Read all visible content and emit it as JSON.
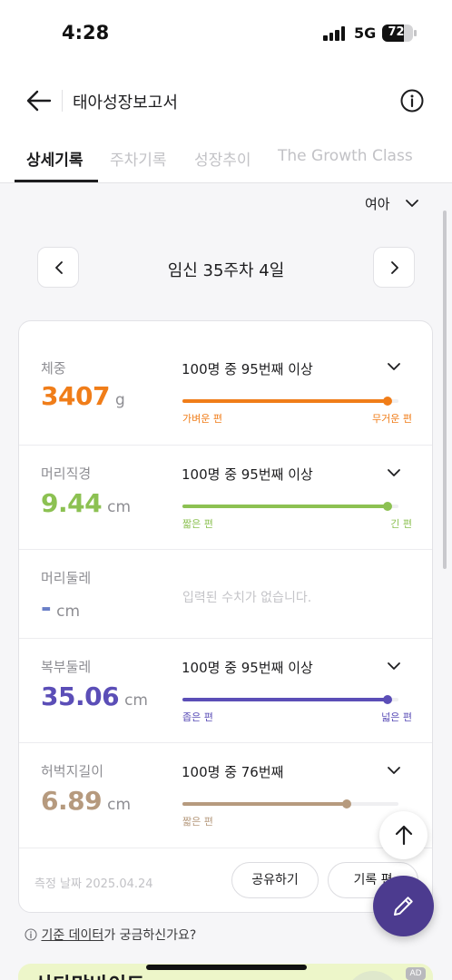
{
  "status_bar": {
    "time": "4:28",
    "network": "5G",
    "battery": "72",
    "battery_level": 0.72
  },
  "header": {
    "title": "태아성장보고서",
    "back_icon": "arrow-left-icon",
    "info_icon": "info-circle-icon"
  },
  "tabs": [
    {
      "label": "상세기록",
      "active": true
    },
    {
      "label": "주차기록",
      "active": false
    },
    {
      "label": "성장추이",
      "active": false
    },
    {
      "label": "The Growth Class",
      "active": false
    }
  ],
  "gender_select": {
    "value": "여아"
  },
  "week": {
    "label": "임신 35주차 4일"
  },
  "measurements": [
    {
      "label": "체중",
      "value": "3407",
      "unit": "g",
      "rank": "100명 중 95번째 이상",
      "low_label": "가벼운 편",
      "high_label": "무거운 편",
      "color": "#f07d19",
      "percentile": 0.95
    },
    {
      "label": "머리직경",
      "value": "9.44",
      "unit": "cm",
      "rank": "100명 중 95번째 이상",
      "low_label": "짧은 편",
      "high_label": "긴 편",
      "color": "#8cc152",
      "percentile": 0.95
    },
    {
      "label": "머리둘레",
      "value": "-",
      "unit": "cm",
      "empty_message": "입력된 수치가 없습니다.",
      "color": "#6a7fc7"
    },
    {
      "label": "복부둘레",
      "value": "35.06",
      "unit": "cm",
      "rank": "100명 중 95번째 이상",
      "low_label": "좁은 편",
      "high_label": "넓은 편",
      "color": "#5b4eb7",
      "percentile": 0.95
    },
    {
      "label": "허벅지길이",
      "value": "6.89",
      "unit": "cm",
      "rank": "100명 중 76번째",
      "low_label": "짧은 편",
      "color": "#b69a7e",
      "percentile": 0.76
    }
  ],
  "footer": {
    "date": "측정 날짜 2025.04.24",
    "share_label": "공유하기",
    "edit_label": "기록 편"
  },
  "help": {
    "link": "기준 데이터",
    "suffix": "가 궁금하신가요?"
  },
  "ad": {
    "text": "산타맘바이트",
    "badge": "AD"
  }
}
